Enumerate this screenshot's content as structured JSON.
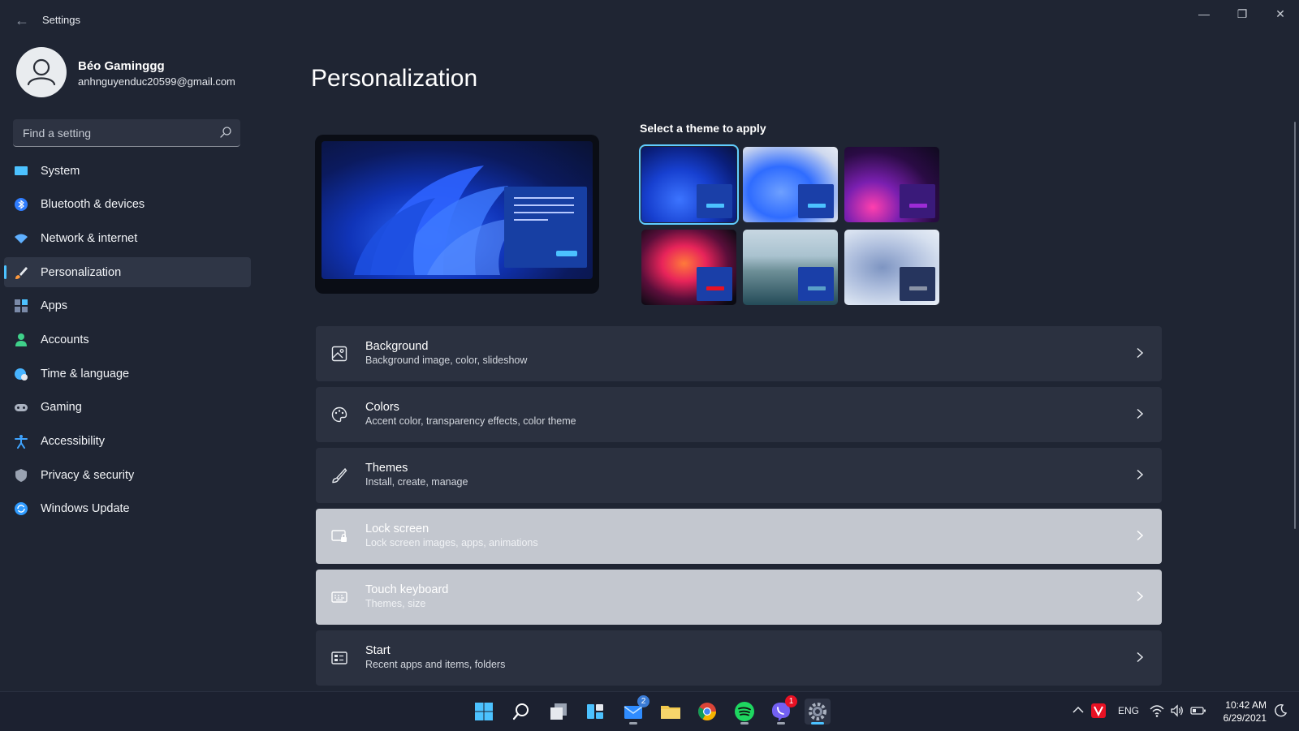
{
  "window": {
    "title": "Settings",
    "controls": {
      "minimize": "—",
      "maximize": "❐",
      "close": "✕"
    }
  },
  "user": {
    "name": "Béo Gaminggg",
    "email": "anhnguyenduc20599@gmail.com"
  },
  "search": {
    "placeholder": "Find a setting"
  },
  "nav": {
    "items": [
      {
        "label": "System",
        "icon": "monitor-icon",
        "color": "#4cc2ff"
      },
      {
        "label": "Bluetooth & devices",
        "icon": "bluetooth-icon",
        "color": "#3a8fff"
      },
      {
        "label": "Network & internet",
        "icon": "wifi-icon",
        "color": "#5fb0ff"
      },
      {
        "label": "Personalization",
        "icon": "brush-icon",
        "color": "#ff9a3d",
        "active": true
      },
      {
        "label": "Apps",
        "icon": "apps-icon",
        "color": "#8aa0c8"
      },
      {
        "label": "Accounts",
        "icon": "person-icon",
        "color": "#3fd18a"
      },
      {
        "label": "Time & language",
        "icon": "globe-clock-icon",
        "color": "#47b4ff"
      },
      {
        "label": "Gaming",
        "icon": "gamepad-icon",
        "color": "#aab2c0"
      },
      {
        "label": "Accessibility",
        "icon": "accessibility-icon",
        "color": "#3fa4ff"
      },
      {
        "label": "Privacy & security",
        "icon": "shield-icon",
        "color": "#9aa3b2"
      },
      {
        "label": "Windows Update",
        "icon": "update-icon",
        "color": "#2f9bff"
      }
    ]
  },
  "main": {
    "title": "Personalization",
    "themes_label": "Select a theme to apply",
    "themes": [
      {
        "name": "windows-light-bloom",
        "selected": true
      },
      {
        "name": "windows-bloom-light"
      },
      {
        "name": "glow"
      },
      {
        "name": "captured-motion"
      },
      {
        "name": "sunrise"
      },
      {
        "name": "flow"
      }
    ],
    "cards": [
      {
        "title": "Background",
        "subtitle": "Background image, color, slideshow",
        "icon": "picture-icon"
      },
      {
        "title": "Colors",
        "subtitle": "Accent color, transparency effects, color theme",
        "icon": "palette-icon"
      },
      {
        "title": "Themes",
        "subtitle": "Install, create, manage",
        "icon": "pen-icon"
      },
      {
        "title": "Lock screen",
        "subtitle": "Lock screen images, apps, animations",
        "icon": "lock-screen-icon",
        "highlight": true
      },
      {
        "title": "Touch keyboard",
        "subtitle": "Themes, size",
        "icon": "keyboard-icon",
        "highlight": true
      },
      {
        "title": "Start",
        "subtitle": "Recent apps and items, folders",
        "icon": "start-icon"
      }
    ]
  },
  "taskbar": {
    "mail_badge": "2",
    "viber_badge": "1",
    "tray": {
      "language": "ENG"
    },
    "clock": {
      "time": "10:42 AM",
      "date": "6/29/2021"
    }
  }
}
